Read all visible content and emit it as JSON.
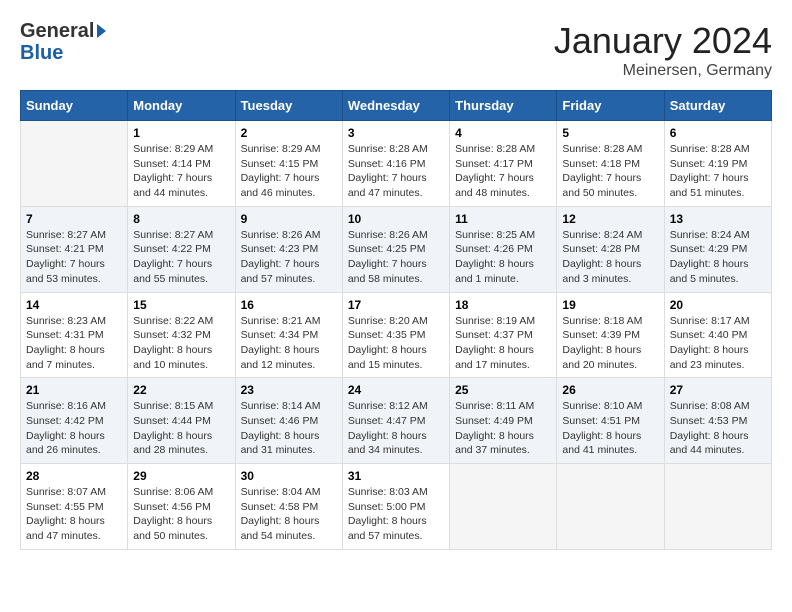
{
  "header": {
    "logo_general": "General",
    "logo_blue": "Blue",
    "month_title": "January 2024",
    "location": "Meinersen, Germany"
  },
  "calendar": {
    "columns": [
      "Sunday",
      "Monday",
      "Tuesday",
      "Wednesday",
      "Thursday",
      "Friday",
      "Saturday"
    ],
    "weeks": [
      [
        {
          "day": "",
          "info": ""
        },
        {
          "day": "1",
          "info": "Sunrise: 8:29 AM\nSunset: 4:14 PM\nDaylight: 7 hours\nand 44 minutes."
        },
        {
          "day": "2",
          "info": "Sunrise: 8:29 AM\nSunset: 4:15 PM\nDaylight: 7 hours\nand 46 minutes."
        },
        {
          "day": "3",
          "info": "Sunrise: 8:28 AM\nSunset: 4:16 PM\nDaylight: 7 hours\nand 47 minutes."
        },
        {
          "day": "4",
          "info": "Sunrise: 8:28 AM\nSunset: 4:17 PM\nDaylight: 7 hours\nand 48 minutes."
        },
        {
          "day": "5",
          "info": "Sunrise: 8:28 AM\nSunset: 4:18 PM\nDaylight: 7 hours\nand 50 minutes."
        },
        {
          "day": "6",
          "info": "Sunrise: 8:28 AM\nSunset: 4:19 PM\nDaylight: 7 hours\nand 51 minutes."
        }
      ],
      [
        {
          "day": "7",
          "info": "Sunrise: 8:27 AM\nSunset: 4:21 PM\nDaylight: 7 hours\nand 53 minutes."
        },
        {
          "day": "8",
          "info": "Sunrise: 8:27 AM\nSunset: 4:22 PM\nDaylight: 7 hours\nand 55 minutes."
        },
        {
          "day": "9",
          "info": "Sunrise: 8:26 AM\nSunset: 4:23 PM\nDaylight: 7 hours\nand 57 minutes."
        },
        {
          "day": "10",
          "info": "Sunrise: 8:26 AM\nSunset: 4:25 PM\nDaylight: 7 hours\nand 58 minutes."
        },
        {
          "day": "11",
          "info": "Sunrise: 8:25 AM\nSunset: 4:26 PM\nDaylight: 8 hours\nand 1 minute."
        },
        {
          "day": "12",
          "info": "Sunrise: 8:24 AM\nSunset: 4:28 PM\nDaylight: 8 hours\nand 3 minutes."
        },
        {
          "day": "13",
          "info": "Sunrise: 8:24 AM\nSunset: 4:29 PM\nDaylight: 8 hours\nand 5 minutes."
        }
      ],
      [
        {
          "day": "14",
          "info": "Sunrise: 8:23 AM\nSunset: 4:31 PM\nDaylight: 8 hours\nand 7 minutes."
        },
        {
          "day": "15",
          "info": "Sunrise: 8:22 AM\nSunset: 4:32 PM\nDaylight: 8 hours\nand 10 minutes."
        },
        {
          "day": "16",
          "info": "Sunrise: 8:21 AM\nSunset: 4:34 PM\nDaylight: 8 hours\nand 12 minutes."
        },
        {
          "day": "17",
          "info": "Sunrise: 8:20 AM\nSunset: 4:35 PM\nDaylight: 8 hours\nand 15 minutes."
        },
        {
          "day": "18",
          "info": "Sunrise: 8:19 AM\nSunset: 4:37 PM\nDaylight: 8 hours\nand 17 minutes."
        },
        {
          "day": "19",
          "info": "Sunrise: 8:18 AM\nSunset: 4:39 PM\nDaylight: 8 hours\nand 20 minutes."
        },
        {
          "day": "20",
          "info": "Sunrise: 8:17 AM\nSunset: 4:40 PM\nDaylight: 8 hours\nand 23 minutes."
        }
      ],
      [
        {
          "day": "21",
          "info": "Sunrise: 8:16 AM\nSunset: 4:42 PM\nDaylight: 8 hours\nand 26 minutes."
        },
        {
          "day": "22",
          "info": "Sunrise: 8:15 AM\nSunset: 4:44 PM\nDaylight: 8 hours\nand 28 minutes."
        },
        {
          "day": "23",
          "info": "Sunrise: 8:14 AM\nSunset: 4:46 PM\nDaylight: 8 hours\nand 31 minutes."
        },
        {
          "day": "24",
          "info": "Sunrise: 8:12 AM\nSunset: 4:47 PM\nDaylight: 8 hours\nand 34 minutes."
        },
        {
          "day": "25",
          "info": "Sunrise: 8:11 AM\nSunset: 4:49 PM\nDaylight: 8 hours\nand 37 minutes."
        },
        {
          "day": "26",
          "info": "Sunrise: 8:10 AM\nSunset: 4:51 PM\nDaylight: 8 hours\nand 41 minutes."
        },
        {
          "day": "27",
          "info": "Sunrise: 8:08 AM\nSunset: 4:53 PM\nDaylight: 8 hours\nand 44 minutes."
        }
      ],
      [
        {
          "day": "28",
          "info": "Sunrise: 8:07 AM\nSunset: 4:55 PM\nDaylight: 8 hours\nand 47 minutes."
        },
        {
          "day": "29",
          "info": "Sunrise: 8:06 AM\nSunset: 4:56 PM\nDaylight: 8 hours\nand 50 minutes."
        },
        {
          "day": "30",
          "info": "Sunrise: 8:04 AM\nSunset: 4:58 PM\nDaylight: 8 hours\nand 54 minutes."
        },
        {
          "day": "31",
          "info": "Sunrise: 8:03 AM\nSunset: 5:00 PM\nDaylight: 8 hours\nand 57 minutes."
        },
        {
          "day": "",
          "info": ""
        },
        {
          "day": "",
          "info": ""
        },
        {
          "day": "",
          "info": ""
        }
      ]
    ]
  }
}
